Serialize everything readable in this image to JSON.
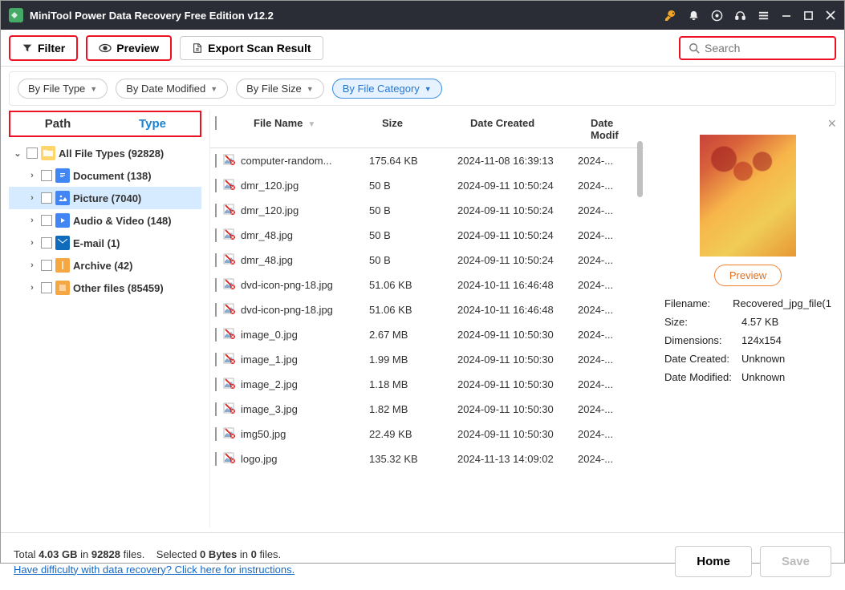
{
  "titlebar": {
    "title": "MiniTool Power Data Recovery Free Edition v12.2"
  },
  "toolbar": {
    "filter": "Filter",
    "preview": "Preview",
    "export": "Export Scan Result"
  },
  "search": {
    "placeholder": "Search"
  },
  "filterchips": {
    "filetype": "By File Type",
    "datemod": "By Date Modified",
    "filesize": "By File Size",
    "category": "By File Category"
  },
  "tabs": {
    "path": "Path",
    "type": "Type"
  },
  "tree": {
    "root": "All File Types (92828)",
    "document": "Document (138)",
    "picture": "Picture (7040)",
    "av": "Audio & Video (148)",
    "email": "E-mail (1)",
    "archive": "Archive (42)",
    "other": "Other files (85459)"
  },
  "table": {
    "headers": {
      "name": "File Name",
      "size": "Size",
      "created": "Date Created",
      "modified": "Date Modif"
    },
    "rows": [
      {
        "name": "computer-random...",
        "size": "175.64 KB",
        "created": "2024-11-08 16:39:13",
        "modified": "2024-..."
      },
      {
        "name": "dmr_120.jpg",
        "size": "50 B",
        "created": "2024-09-11 10:50:24",
        "modified": "2024-..."
      },
      {
        "name": "dmr_120.jpg",
        "size": "50 B",
        "created": "2024-09-11 10:50:24",
        "modified": "2024-..."
      },
      {
        "name": "dmr_48.jpg",
        "size": "50 B",
        "created": "2024-09-11 10:50:24",
        "modified": "2024-..."
      },
      {
        "name": "dmr_48.jpg",
        "size": "50 B",
        "created": "2024-09-11 10:50:24",
        "modified": "2024-..."
      },
      {
        "name": "dvd-icon-png-18.jpg",
        "size": "51.06 KB",
        "created": "2024-10-11 16:46:48",
        "modified": "2024-..."
      },
      {
        "name": "dvd-icon-png-18.jpg",
        "size": "51.06 KB",
        "created": "2024-10-11 16:46:48",
        "modified": "2024-..."
      },
      {
        "name": "image_0.jpg",
        "size": "2.67 MB",
        "created": "2024-09-11 10:50:30",
        "modified": "2024-..."
      },
      {
        "name": "image_1.jpg",
        "size": "1.99 MB",
        "created": "2024-09-11 10:50:30",
        "modified": "2024-..."
      },
      {
        "name": "image_2.jpg",
        "size": "1.18 MB",
        "created": "2024-09-11 10:50:30",
        "modified": "2024-..."
      },
      {
        "name": "image_3.jpg",
        "size": "1.82 MB",
        "created": "2024-09-11 10:50:30",
        "modified": "2024-..."
      },
      {
        "name": "img50.jpg",
        "size": "22.49 KB",
        "created": "2024-09-11 10:50:30",
        "modified": "2024-..."
      },
      {
        "name": "logo.jpg",
        "size": "135.32 KB",
        "created": "2024-11-13 14:09:02",
        "modified": "2024-..."
      }
    ]
  },
  "preview": {
    "btn": "Preview",
    "filename_k": "Filename:",
    "filename_v": "Recovered_jpg_file(1",
    "size_k": "Size:",
    "size_v": "4.57 KB",
    "dim_k": "Dimensions:",
    "dim_v": "124x154",
    "created_k": "Date Created:",
    "created_v": "Unknown",
    "modified_k": "Date Modified:",
    "modified_v": "Unknown"
  },
  "footer": {
    "total_a": "Total ",
    "total_b": "4.03 GB",
    "total_c": " in ",
    "total_d": "92828",
    "total_e": " files.",
    "sel_a": "Selected ",
    "sel_b": "0 Bytes",
    "sel_c": " in ",
    "sel_d": "0",
    "sel_e": " files.",
    "help": "Have difficulty with data recovery? Click here for instructions.",
    "home": "Home",
    "save": "Save"
  }
}
